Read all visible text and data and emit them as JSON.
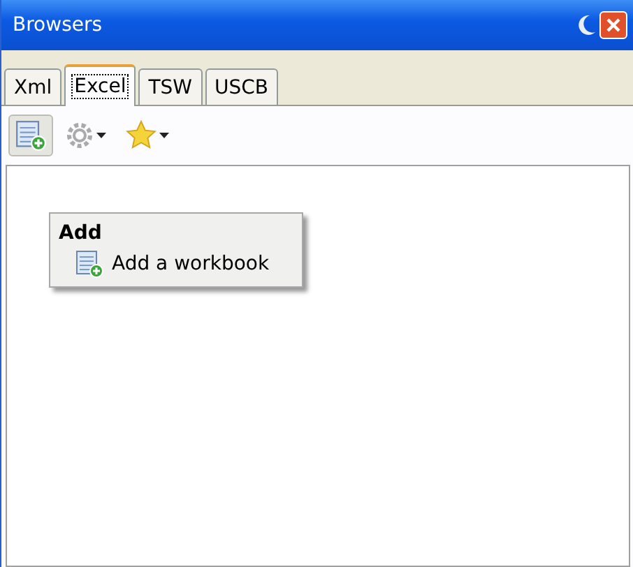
{
  "window": {
    "title": "Browsers"
  },
  "tabs": [
    {
      "label": "Xml",
      "selected": false
    },
    {
      "label": "Excel",
      "selected": true
    },
    {
      "label": "TSW",
      "selected": false
    },
    {
      "label": "USCB",
      "selected": false
    }
  ],
  "toolbar": [
    {
      "kind": "add",
      "pressed": true,
      "dropdown": false
    },
    {
      "kind": "gear",
      "pressed": false,
      "dropdown": true
    },
    {
      "kind": "star",
      "pressed": false,
      "dropdown": true
    }
  ],
  "menu": {
    "heading": "Add",
    "items": [
      {
        "label": "Add a workbook"
      }
    ]
  }
}
